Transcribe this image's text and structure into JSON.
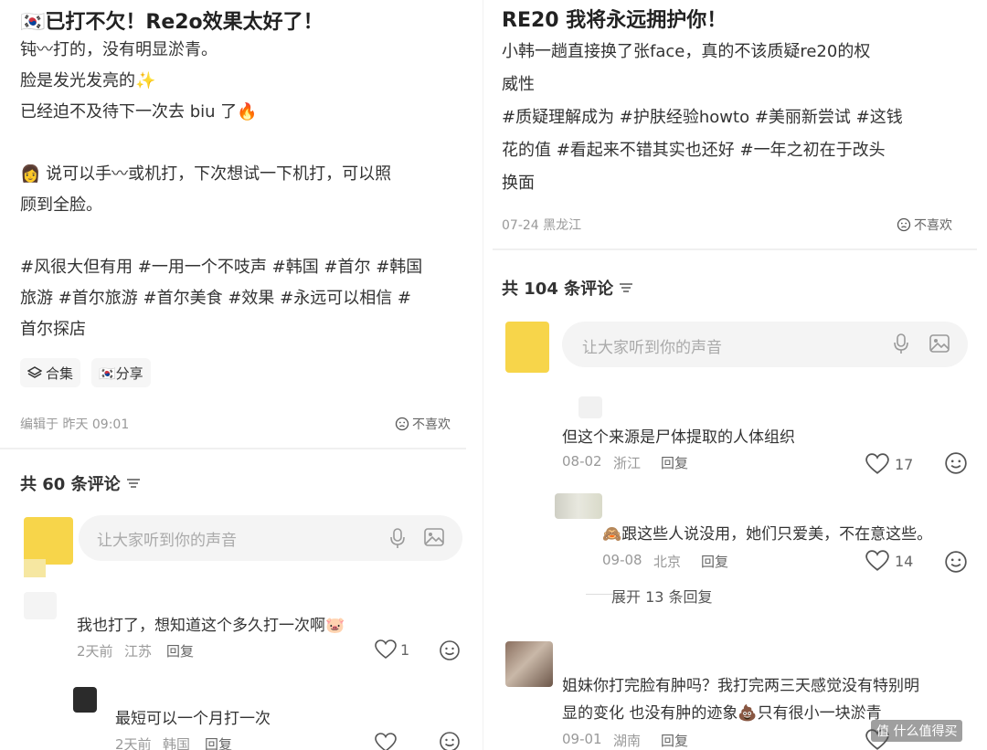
{
  "left": {
    "title": "🇰🇷已打不欠！Re2o效果太好了！",
    "lines": [
      "钝〰打的，没有明显淤青。",
      "脸是发光发亮的✨",
      "已经迫不及待下一次去 biu 了🔥",
      "👩 说可以手〰或机打，下次想试一下机打，可以照",
      "顾到全脸。",
      "#风很大但有用 #一用一个不吱声 #韩国 #首尔 #韩国",
      "旅游 #首尔旅游 #首尔美食 #效果 #永远可以相信 #",
      "首尔探店"
    ],
    "chips": [
      "合集",
      "🇰🇷分享"
    ],
    "edit_meta": "编辑于 昨天 09:01",
    "dislike": "不喜欢",
    "comment_count": "共 60 条评论",
    "input_placeholder": "让大家听到你的声音",
    "comments": [
      {
        "text": "我也打了，想知道这个多久打一次啊🐷",
        "time": "2天前",
        "loc": "江苏",
        "reply": "回复",
        "likes": "1"
      },
      {
        "text": "最短可以一个月打一次",
        "time": "2天前",
        "loc": "韩国",
        "reply": "回复",
        "likes": ""
      }
    ]
  },
  "right": {
    "title": "RE20 我将永远拥护你！",
    "lines": [
      "小韩一趟直接换了张face，真的不该质疑re20的权",
      "威性",
      "#质疑理解成为 #护肤经验howto #美丽新尝试 #这钱",
      "花的值 #看起来不错其实也还好 #一年之初在于改头",
      "换面"
    ],
    "date_meta": "07-24 黑龙江",
    "dislike": "不喜欢",
    "comment_count": "共 104 条评论",
    "input_placeholder": "让大家听到你的声音",
    "comments": [
      {
        "text": "但这个来源是尸体提取的人体组织",
        "time": "08-02",
        "loc": "浙江",
        "reply": "回复",
        "likes": "17"
      },
      {
        "text": "🙈跟这些人说没用，她们只爱美，不在意这些。",
        "time": "09-08",
        "loc": "北京",
        "reply": "回复",
        "likes": "14"
      },
      {
        "text_line1": "姐妹你打完脸有肿吗？我打完两三天感觉没有特别明",
        "text_line2": "显的变化 也没有肿的迹象💩只有很小一块淤青",
        "time": "09-01",
        "loc": "湖南",
        "reply": "回复",
        "likes": ""
      }
    ],
    "expand": "展开 13 条回复",
    "watermark": "值 什么值得买"
  },
  "icons": [
    "mic-icon",
    "image-icon",
    "heart-icon",
    "emoji-icon",
    "dislike-face-icon",
    "filter-icon",
    "layers-icon"
  ],
  "colors": {
    "accent_yellow": "#f7d54a",
    "text": "#333333",
    "muted": "#999999"
  }
}
